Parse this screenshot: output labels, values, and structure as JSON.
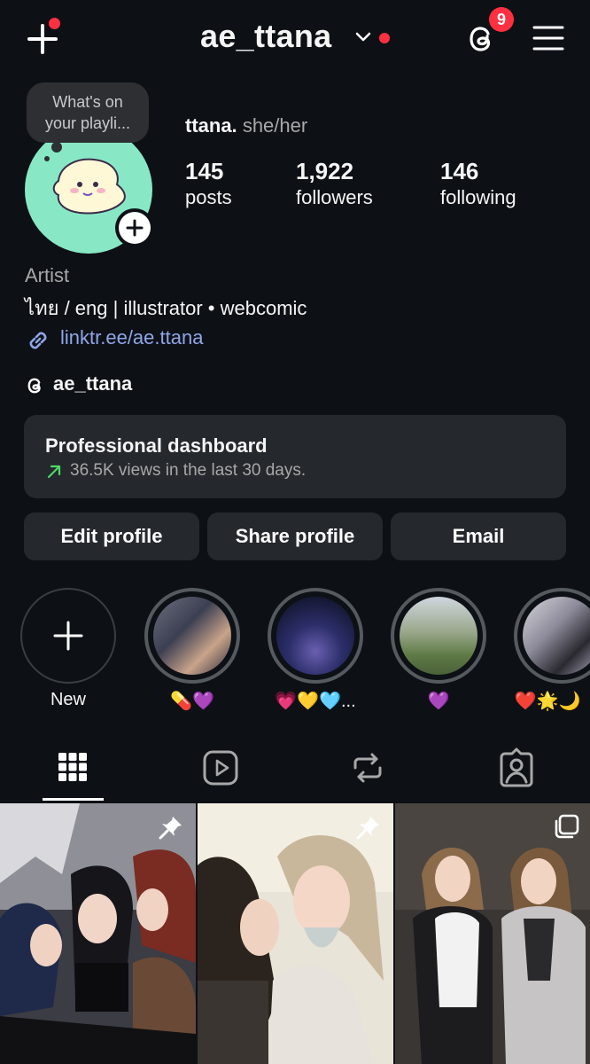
{
  "header": {
    "username": "ae_ttana",
    "notification_count": "9"
  },
  "profile": {
    "note_line1": "What's on",
    "note_line2": "your playli...",
    "display_name": "ttana.",
    "pronouns": "she/her",
    "stats": [
      {
        "number": "145",
        "label": "posts"
      },
      {
        "number": "1,922",
        "label": "followers"
      },
      {
        "number": "146",
        "label": "following"
      }
    ],
    "category": "Artist",
    "bio": "ไทย / eng | illustrator • webcomic",
    "link": "linktr.ee/ae.ttana",
    "threads_handle": "ae_ttana"
  },
  "dashboard": {
    "title": "Professional dashboard",
    "subtitle": "36.5K views in the last 30 days."
  },
  "actions": {
    "edit": "Edit profile",
    "share": "Share profile",
    "email": "Email"
  },
  "highlights": [
    {
      "label": "New"
    },
    {
      "label": "💊💜"
    },
    {
      "label": "💗💛🩵..."
    },
    {
      "label": "💜"
    },
    {
      "label": "❤️🌟🌙"
    }
  ],
  "colors": {
    "background": "#0d1116",
    "surface": "#25282d",
    "accent_red": "#ff3040",
    "link": "#8fa6e8",
    "trend_green": "#4cd964"
  },
  "tabs": [
    "grid-icon",
    "reels-icon",
    "reposts-icon",
    "tagged-icon"
  ]
}
